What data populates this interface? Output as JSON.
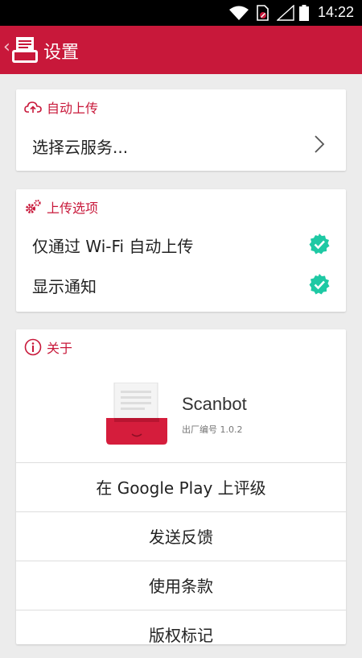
{
  "status_bar": {
    "time": "14:22"
  },
  "app_bar": {
    "title": "设置"
  },
  "auto_upload": {
    "header": "自动上传",
    "choose_cloud": "选择云服务..."
  },
  "upload_options": {
    "header": "上传选项",
    "options": [
      {
        "label": "仅通过 Wi-Fi 自动上传",
        "checked": true
      },
      {
        "label": "显示通知",
        "checked": true
      }
    ]
  },
  "about": {
    "header": "关于",
    "app_name": "Scanbot",
    "build": "出厂编号 1.0.2",
    "links": [
      {
        "label": "在 Google Play 上评级"
      },
      {
        "label": "发送反馈"
      },
      {
        "label": "使用条款"
      },
      {
        "label": "版权标记"
      }
    ]
  },
  "colors": {
    "brand": "#c8183a",
    "check": "#1ec9a4",
    "background": "#ececec"
  }
}
